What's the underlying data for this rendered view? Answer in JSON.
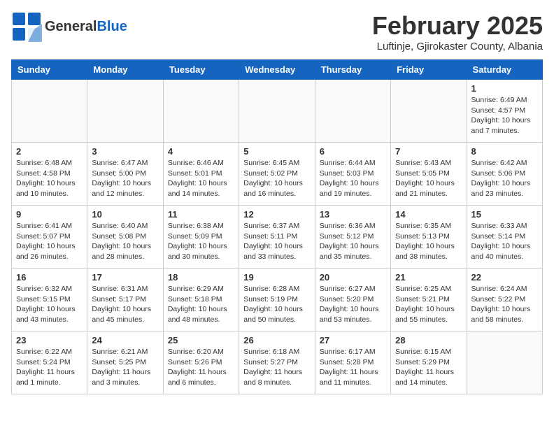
{
  "header": {
    "logo_general": "General",
    "logo_blue": "Blue",
    "title": "February 2025",
    "subtitle": "Luftinje, Gjirokaster County, Albania"
  },
  "weekdays": [
    "Sunday",
    "Monday",
    "Tuesday",
    "Wednesday",
    "Thursday",
    "Friday",
    "Saturday"
  ],
  "weeks": [
    [
      {
        "day": "",
        "info": ""
      },
      {
        "day": "",
        "info": ""
      },
      {
        "day": "",
        "info": ""
      },
      {
        "day": "",
        "info": ""
      },
      {
        "day": "",
        "info": ""
      },
      {
        "day": "",
        "info": ""
      },
      {
        "day": "1",
        "info": "Sunrise: 6:49 AM\nSunset: 4:57 PM\nDaylight: 10 hours\nand 7 minutes."
      }
    ],
    [
      {
        "day": "2",
        "info": "Sunrise: 6:48 AM\nSunset: 4:58 PM\nDaylight: 10 hours\nand 10 minutes."
      },
      {
        "day": "3",
        "info": "Sunrise: 6:47 AM\nSunset: 5:00 PM\nDaylight: 10 hours\nand 12 minutes."
      },
      {
        "day": "4",
        "info": "Sunrise: 6:46 AM\nSunset: 5:01 PM\nDaylight: 10 hours\nand 14 minutes."
      },
      {
        "day": "5",
        "info": "Sunrise: 6:45 AM\nSunset: 5:02 PM\nDaylight: 10 hours\nand 16 minutes."
      },
      {
        "day": "6",
        "info": "Sunrise: 6:44 AM\nSunset: 5:03 PM\nDaylight: 10 hours\nand 19 minutes."
      },
      {
        "day": "7",
        "info": "Sunrise: 6:43 AM\nSunset: 5:05 PM\nDaylight: 10 hours\nand 21 minutes."
      },
      {
        "day": "8",
        "info": "Sunrise: 6:42 AM\nSunset: 5:06 PM\nDaylight: 10 hours\nand 23 minutes."
      }
    ],
    [
      {
        "day": "9",
        "info": "Sunrise: 6:41 AM\nSunset: 5:07 PM\nDaylight: 10 hours\nand 26 minutes."
      },
      {
        "day": "10",
        "info": "Sunrise: 6:40 AM\nSunset: 5:08 PM\nDaylight: 10 hours\nand 28 minutes."
      },
      {
        "day": "11",
        "info": "Sunrise: 6:38 AM\nSunset: 5:09 PM\nDaylight: 10 hours\nand 30 minutes."
      },
      {
        "day": "12",
        "info": "Sunrise: 6:37 AM\nSunset: 5:11 PM\nDaylight: 10 hours\nand 33 minutes."
      },
      {
        "day": "13",
        "info": "Sunrise: 6:36 AM\nSunset: 5:12 PM\nDaylight: 10 hours\nand 35 minutes."
      },
      {
        "day": "14",
        "info": "Sunrise: 6:35 AM\nSunset: 5:13 PM\nDaylight: 10 hours\nand 38 minutes."
      },
      {
        "day": "15",
        "info": "Sunrise: 6:33 AM\nSunset: 5:14 PM\nDaylight: 10 hours\nand 40 minutes."
      }
    ],
    [
      {
        "day": "16",
        "info": "Sunrise: 6:32 AM\nSunset: 5:15 PM\nDaylight: 10 hours\nand 43 minutes."
      },
      {
        "day": "17",
        "info": "Sunrise: 6:31 AM\nSunset: 5:17 PM\nDaylight: 10 hours\nand 45 minutes."
      },
      {
        "day": "18",
        "info": "Sunrise: 6:29 AM\nSunset: 5:18 PM\nDaylight: 10 hours\nand 48 minutes."
      },
      {
        "day": "19",
        "info": "Sunrise: 6:28 AM\nSunset: 5:19 PM\nDaylight: 10 hours\nand 50 minutes."
      },
      {
        "day": "20",
        "info": "Sunrise: 6:27 AM\nSunset: 5:20 PM\nDaylight: 10 hours\nand 53 minutes."
      },
      {
        "day": "21",
        "info": "Sunrise: 6:25 AM\nSunset: 5:21 PM\nDaylight: 10 hours\nand 55 minutes."
      },
      {
        "day": "22",
        "info": "Sunrise: 6:24 AM\nSunset: 5:22 PM\nDaylight: 10 hours\nand 58 minutes."
      }
    ],
    [
      {
        "day": "23",
        "info": "Sunrise: 6:22 AM\nSunset: 5:24 PM\nDaylight: 11 hours\nand 1 minute."
      },
      {
        "day": "24",
        "info": "Sunrise: 6:21 AM\nSunset: 5:25 PM\nDaylight: 11 hours\nand 3 minutes."
      },
      {
        "day": "25",
        "info": "Sunrise: 6:20 AM\nSunset: 5:26 PM\nDaylight: 11 hours\nand 6 minutes."
      },
      {
        "day": "26",
        "info": "Sunrise: 6:18 AM\nSunset: 5:27 PM\nDaylight: 11 hours\nand 8 minutes."
      },
      {
        "day": "27",
        "info": "Sunrise: 6:17 AM\nSunset: 5:28 PM\nDaylight: 11 hours\nand 11 minutes."
      },
      {
        "day": "28",
        "info": "Sunrise: 6:15 AM\nSunset: 5:29 PM\nDaylight: 11 hours\nand 14 minutes."
      },
      {
        "day": "",
        "info": ""
      }
    ]
  ]
}
